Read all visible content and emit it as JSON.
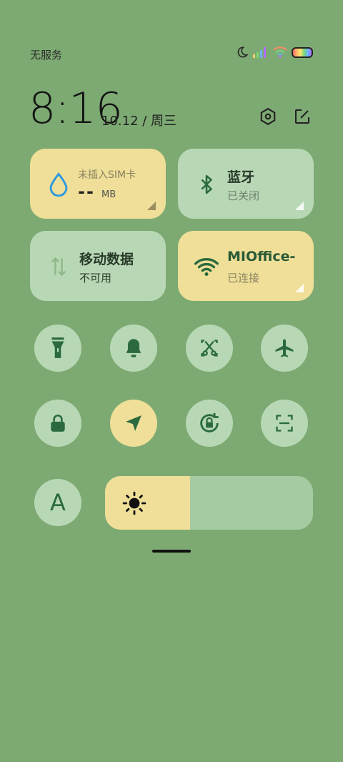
{
  "status_bar": {
    "carrier": "无服务",
    "icons": [
      "moon-icon",
      "signal-icon",
      "wifi-icon",
      "battery-icon"
    ]
  },
  "clock": {
    "time": "8:16",
    "date": "10.12 / 周三"
  },
  "header_actions": [
    "settings-icon",
    "edit-icon"
  ],
  "tiles": {
    "data_usage": {
      "title": "未插入SIM卡",
      "value": "--",
      "unit": "MB",
      "icon": "water-drop-icon"
    },
    "bluetooth": {
      "title": "蓝牙",
      "subtitle": "已关闭",
      "icon": "bluetooth-icon"
    },
    "mobile_data": {
      "title": "移动数据",
      "subtitle": "不可用",
      "icon": "data-arrows-icon"
    },
    "wifi": {
      "title": "MIOffice-",
      "subtitle": "已连接",
      "icon": "wifi-icon"
    }
  },
  "toggles_row1": [
    "flashlight-icon",
    "bell-icon",
    "screenshot-icon",
    "airplane-icon"
  ],
  "toggles_row2": [
    "lock-icon",
    "location-icon",
    "rotation-lock-icon",
    "scan-icon"
  ],
  "font_button": {
    "label": "A"
  },
  "brightness": {
    "level": 0.41
  },
  "colors": {
    "background": "#7daa72",
    "tile_active": "#efdf98",
    "tile_inactive": "#b8d8b5",
    "icon": "#2a6a3e"
  }
}
